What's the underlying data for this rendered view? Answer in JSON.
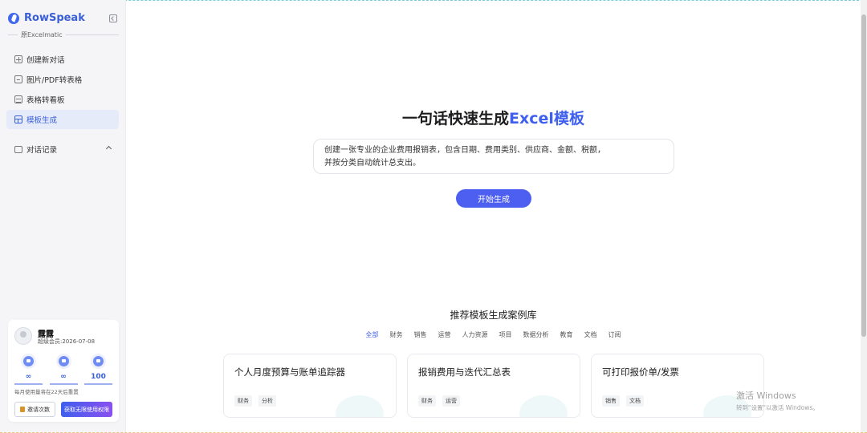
{
  "brand": {
    "name": "RowSpeak",
    "subtitle": "原Excelmatic"
  },
  "nav": {
    "items": [
      {
        "label": "创建新对话",
        "icon": "plus-square-icon"
      },
      {
        "label": "图片/PDF转表格",
        "icon": "image-icon"
      },
      {
        "label": "表格转看板",
        "icon": "table-icon"
      },
      {
        "label": "模板生成",
        "icon": "template-icon",
        "active": true
      }
    ],
    "history_label": "对话记录"
  },
  "user": {
    "name": "露露",
    "membership": "超级会员:2026-07-08",
    "stats": [
      {
        "icon": "chat-quota-icon",
        "value": "∞"
      },
      {
        "icon": "image-quota-icon",
        "value": "∞"
      },
      {
        "icon": "chart-quota-icon",
        "value": "100"
      }
    ],
    "quota_note": "每月使用量将在22天后重置",
    "invite_label": "邀请次数",
    "upgrade_label": "获取无限使用权限"
  },
  "hero": {
    "title_prefix": "一句话快速生成",
    "title_accent": "Excel模板",
    "prompt_line1": "创建一张专业的企业费用报销表，包含日期、费用类别、供应商、金额、税额，",
    "prompt_line2": "并按分类自动统计总支出。",
    "start_label": "开始生成"
  },
  "library": {
    "title": "推荐模板生成案例库",
    "filters": [
      "全部",
      "财务",
      "销售",
      "运营",
      "人力资源",
      "项目",
      "数据分析",
      "教育",
      "文档",
      "订阅"
    ],
    "active_filter": "全部",
    "cards": [
      {
        "title": "个人月度预算与账单追踪器",
        "tags": [
          "财务",
          "分析"
        ]
      },
      {
        "title": "报销费用与迭代汇总表",
        "tags": [
          "财务",
          "运营"
        ]
      },
      {
        "title": "可打印报价单/发票",
        "tags": [
          "销售",
          "文档"
        ]
      }
    ]
  },
  "watermark": {
    "line1": "激活 Windows",
    "line2": "转到\"设置\"以激活 Windows。"
  },
  "colors": {
    "accent": "#3f5fee",
    "sidebar_bg": "#f5f5f7",
    "active_nav_bg": "#e6ebfa"
  }
}
